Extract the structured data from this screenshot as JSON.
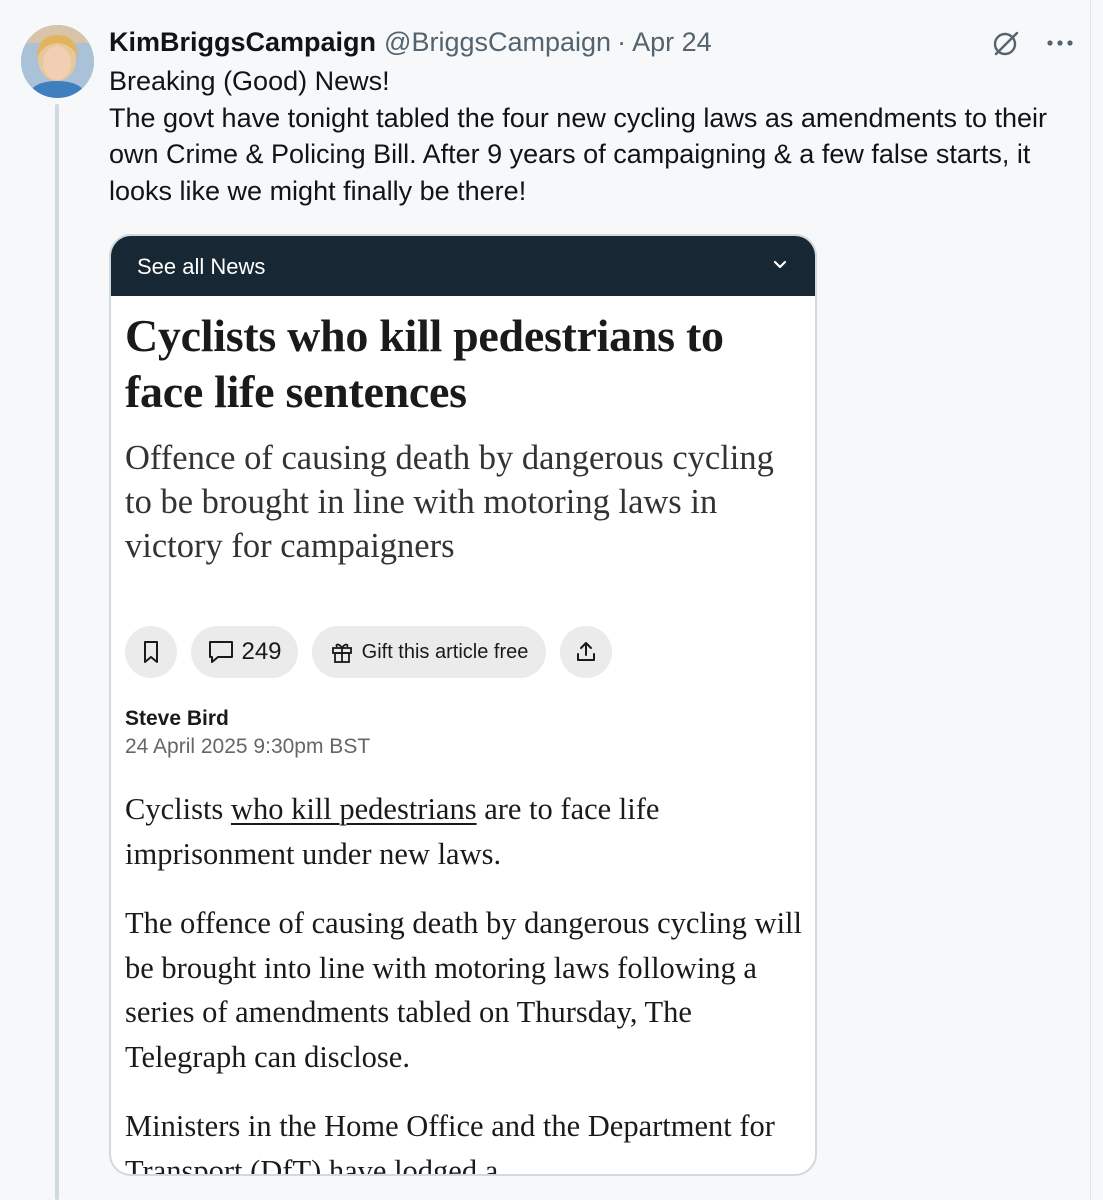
{
  "tweet": {
    "display_name": "KimBriggsCampaign",
    "handle": "@BriggsCampaign",
    "separator": "·",
    "date": "Apr 24",
    "line1": "Breaking (Good) News!",
    "line2": "The govt have tonight tabled the four new cycling laws as amendments to their own Crime & Policing Bill. After 9 years of campaigning & a few false starts, it looks like we might finally be there!",
    "icons": {
      "grok": "grok-icon",
      "more": "more-icon"
    }
  },
  "article": {
    "nav_label": "See all News",
    "headline": "Cyclists who kill pedestrians to face life sentences",
    "standfirst": "Offence of causing death by dangerous cycling to be brought in line with motoring laws in victory for campaigners",
    "comment_count": "249",
    "gift_label": "Gift this article free",
    "author": "Steve Bird",
    "timestamp": "24 April 2025 9:30pm BST",
    "para1_before": "Cyclists ",
    "para1_link": "who kill pedestrians",
    "para1_after": " are to face life imprisonment under new laws.",
    "para2": "The offence of causing death by dangerous cycling will be brought into line with motoring laws following a series of amendments tabled on Thursday, The Telegraph can disclose.",
    "para3": "Ministers in the Home Office and the Department for Transport (DfT) have lodged a"
  },
  "colors": {
    "nav_bar": "#172733",
    "pill": "#ebebeb",
    "thread_line": "#cfd9de",
    "muted_text": "#536471"
  }
}
